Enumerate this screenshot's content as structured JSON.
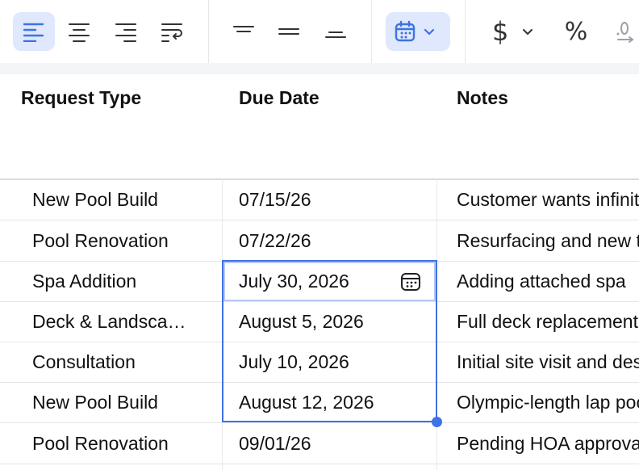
{
  "toolbar": {
    "accent": "#3f72e4",
    "active_bg": "#dfe8fc",
    "buttons": [
      {
        "name": "align-left",
        "icon": "align-left-icon",
        "active": true
      },
      {
        "name": "align-center",
        "icon": "align-center-icon",
        "active": false
      },
      {
        "name": "align-right",
        "icon": "align-right-icon",
        "active": false
      },
      {
        "name": "wrap-text",
        "icon": "wrap-text-icon",
        "active": false
      },
      {
        "name": "valign-top",
        "icon": "valign-top-icon",
        "active": false
      },
      {
        "name": "valign-middle",
        "icon": "valign-middle-icon",
        "active": false
      },
      {
        "name": "valign-bottom",
        "icon": "valign-bottom-icon",
        "active": false
      },
      {
        "name": "date-format",
        "icon": "calendar-icon",
        "active": true
      },
      {
        "name": "currency-format",
        "icon": "dollar-icon",
        "active": false
      },
      {
        "name": "percent-format",
        "icon": "percent-icon",
        "active": false
      },
      {
        "name": "decimal-format",
        "icon": "decimal-icon",
        "active": false
      }
    ]
  },
  "table": {
    "headers": [
      "Request Type",
      "Due Date",
      "Notes"
    ],
    "rows": [
      {
        "type": "New Pool Build",
        "due": "07/15/26",
        "notes": "Customer wants infinity edge"
      },
      {
        "type": "Pool Renovation",
        "due": "07/22/26",
        "notes": "Resurfacing and new tile"
      },
      {
        "type": "Spa Addition",
        "due": "July 30, 2026",
        "notes": "Adding attached spa"
      },
      {
        "type": "Deck & Landscaping",
        "due": "August 5, 2026",
        "notes": "Full deck replacement"
      },
      {
        "type": "Consultation",
        "due": "July 10, 2026",
        "notes": "Initial site visit and design"
      },
      {
        "type": "New Pool Build",
        "due": "August 12, 2026",
        "notes": "Olympic-length lap pool"
      },
      {
        "type": "Pool Renovation",
        "due": "09/01/26",
        "notes": "Pending HOA approval"
      }
    ],
    "active_cell_icon": "calendar-icon"
  }
}
